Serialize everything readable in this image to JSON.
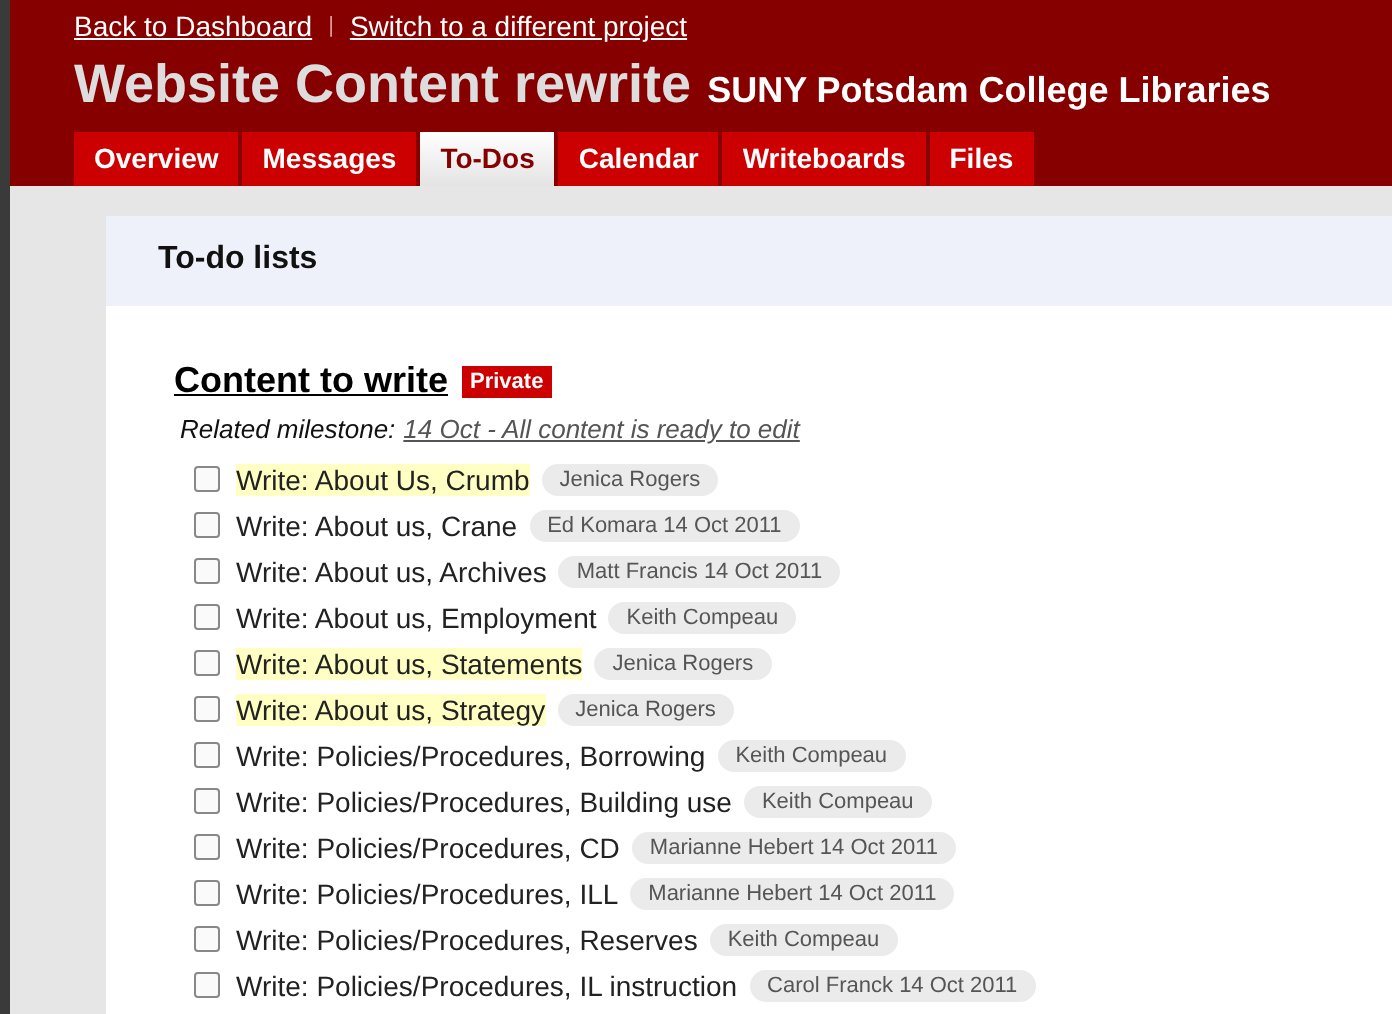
{
  "header": {
    "links": [
      "Back to Dashboard",
      "Switch to a different project"
    ],
    "separator": "|",
    "project_title": "Website Content rewrite",
    "company": "SUNY Potsdam College Libraries"
  },
  "tabs": [
    {
      "label": "Overview",
      "selected": false
    },
    {
      "label": "Messages",
      "selected": false
    },
    {
      "label": "To-Dos",
      "selected": true
    },
    {
      "label": "Calendar",
      "selected": false
    },
    {
      "label": "Writeboards",
      "selected": false
    },
    {
      "label": "Files",
      "selected": false
    }
  ],
  "page_title": "To-do lists",
  "list": {
    "title": "Content to write",
    "badge": "Private",
    "milestone_label": "Related milestone:",
    "milestone": "14 Oct - All content is ready to edit",
    "items": [
      {
        "text": "Write: About Us, Crumb",
        "assignee": "Jenica Rogers",
        "highlighted": true,
        "checked": false
      },
      {
        "text": "Write: About us, Crane",
        "assignee": "Ed Komara 14 Oct 2011",
        "highlighted": false,
        "checked": false
      },
      {
        "text": "Write: About us, Archives",
        "assignee": "Matt Francis 14 Oct 2011",
        "highlighted": false,
        "checked": false
      },
      {
        "text": "Write: About us, Employment",
        "assignee": "Keith Compeau",
        "highlighted": false,
        "checked": false
      },
      {
        "text": "Write: About us, Statements",
        "assignee": "Jenica Rogers",
        "highlighted": true,
        "checked": false
      },
      {
        "text": "Write: About us, Strategy",
        "assignee": "Jenica Rogers",
        "highlighted": true,
        "checked": false
      },
      {
        "text": "Write: Policies/Procedures, Borrowing",
        "assignee": "Keith Compeau",
        "highlighted": false,
        "checked": false
      },
      {
        "text": "Write: Policies/Procedures, Building use",
        "assignee": "Keith Compeau",
        "highlighted": false,
        "checked": false
      },
      {
        "text": "Write: Policies/Procedures, CD",
        "assignee": "Marianne Hebert 14 Oct 2011",
        "highlighted": false,
        "checked": false
      },
      {
        "text": "Write: Policies/Procedures, ILL",
        "assignee": "Marianne Hebert 14 Oct 2011",
        "highlighted": false,
        "checked": false
      },
      {
        "text": "Write: Policies/Procedures, Reserves",
        "assignee": "Keith Compeau",
        "highlighted": false,
        "checked": false
      },
      {
        "text": "Write: Policies/Procedures, IL instruction",
        "assignee": "Carol Franck 14 Oct 2011",
        "highlighted": false,
        "checked": false
      }
    ]
  }
}
